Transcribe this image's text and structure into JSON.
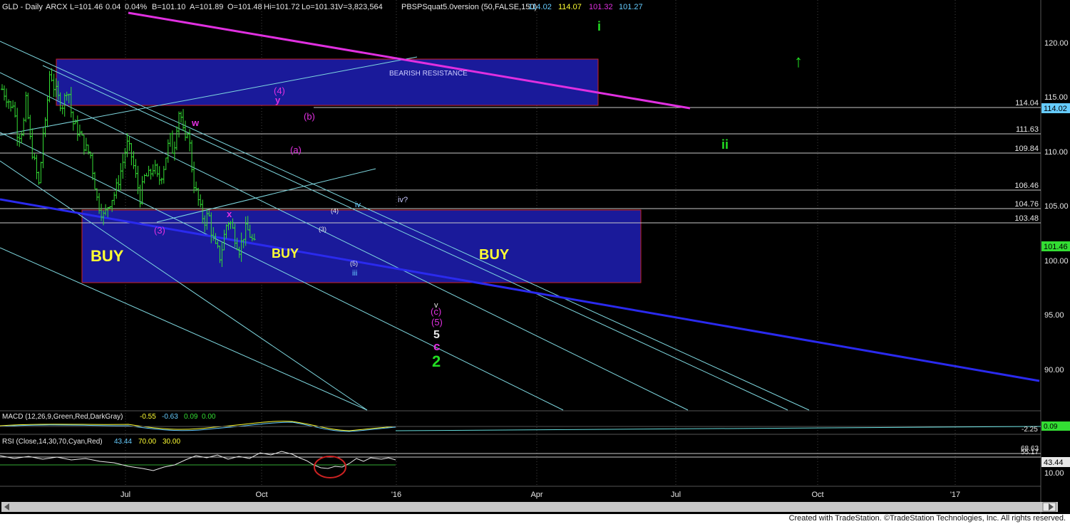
{
  "header": {
    "symbol": "GLD - Daily",
    "exchange": "ARCX",
    "last": "L=101.46",
    "change": "0.04",
    "change_pct": "0.04%",
    "bid": "B=101.10",
    "ask": "A=101.89",
    "open": "O=101.48",
    "high": "Hi=101.72",
    "low": "Lo=101.31",
    "volume": "V=3,823,564",
    "study": "PBSPSquat5.0version (50,FALSE,150)",
    "study_values": [
      "114.02",
      "114.07",
      "101.32",
      "101.27"
    ]
  },
  "price_axis": {
    "ticks": [
      "120.00",
      "115.00",
      "110.00",
      "105.00",
      "100.00",
      "95.00",
      "90.00"
    ],
    "current_price_tag": "101.46",
    "resistance_tag": "114.02"
  },
  "levels": [
    "114.04",
    "111.63",
    "109.84",
    "106.46",
    "104.76",
    "103.48"
  ],
  "time_axis": [
    "Jul",
    "Oct",
    "'16",
    "Apr",
    "Jul",
    "Oct",
    "'17"
  ],
  "annotations": {
    "zone_bearish": "BEARISH RESISTANCE",
    "buy_left": "BUY",
    "buy_mid": "BUY",
    "buy_right": "BUY",
    "wave_i": "i",
    "wave_ii": "ii",
    "arrow_up": "↑",
    "w": "w",
    "x": "x",
    "y": "y",
    "w4": "(4)",
    "w3": "(3)",
    "b": "(b)",
    "a": "(a)",
    "iv": "iv",
    "iv_q": "iv?",
    "sub3": "(3)",
    "sub4": "(4)",
    "sub5": "(5)",
    "iii": "iii",
    "v_small": "v",
    "c_paren": "(c)",
    "five_paren": "(5)",
    "five": "5",
    "c": "c",
    "two": "2"
  },
  "macd": {
    "label": "MACD (12,26,9,Green,Red,DarkGray)",
    "values": [
      "-0.55",
      "-0.63",
      "0.09",
      "0.00"
    ],
    "axis_label": "-2.25",
    "tag": "0.09"
  },
  "rsi": {
    "label": "RSI (Close,14,30,70,Cyan,Red)",
    "values": [
      "43.44",
      "70.00",
      "30.00"
    ],
    "axis_labels": [
      "68.63",
      "55.17",
      "10.00"
    ],
    "tag": "43.44"
  },
  "footer": "Created with TradeStation. ©TradeStation Technologies, Inc. All rights reserved.",
  "colors": {
    "background": "#000000",
    "zone_fill": "#1a1a9a",
    "zone_border": "#cc2222",
    "magenta": "#e030e0",
    "blue_trend": "#2a2aee",
    "cyan": "#7fd8e0",
    "level": "#c8c8c8",
    "buy_text": "#ffff33",
    "wave_green": "#22dd22",
    "price_bar": "#33dd33"
  },
  "chart_data": {
    "type": "bar",
    "symbol": "GLD",
    "period": "Daily",
    "x": [
      "Jul",
      "Oct",
      "'16",
      "Apr",
      "Jul",
      "Oct",
      "'17"
    ],
    "ylim": [
      87.5,
      121.5
    ],
    "price_path": [
      {
        "t": 0,
        "price": 116.0
      },
      {
        "t": 0.14,
        "price": 115.0
      },
      {
        "t": 0.2,
        "price": 114.0
      },
      {
        "t": 0.26,
        "price": 115.2
      },
      {
        "t": 0.3,
        "price": 112.5
      },
      {
        "t": 0.36,
        "price": 111.8
      },
      {
        "t": 0.43,
        "price": 112.2
      },
      {
        "t": 0.48,
        "price": 113.0
      },
      {
        "t": 0.54,
        "price": 115.5
      },
      {
        "t": 0.59,
        "price": 112.0
      },
      {
        "t": 0.7,
        "price": 109.5
      },
      {
        "t": 0.82,
        "price": 107.0
      },
      {
        "t": 0.9,
        "price": 112.0
      },
      {
        "t": 0.95,
        "price": 112.5
      },
      {
        "t": 1.0,
        "price": 115.0
      },
      {
        "t": 1.06,
        "price": 118.0
      },
      {
        "t": 1.12,
        "price": 116.5
      },
      {
        "t": 1.25,
        "price": 115.0
      },
      {
        "t": 1.35,
        "price": 114.5
      },
      {
        "t": 1.45,
        "price": 116.5
      },
      {
        "t": 1.55,
        "price": 113.0
      },
      {
        "t": 1.7,
        "price": 112.0
      },
      {
        "t": 1.85,
        "price": 110.5
      },
      {
        "t": 1.95,
        "price": 110.0
      },
      {
        "t": 2.1,
        "price": 105.8
      },
      {
        "t": 2.25,
        "price": 104.2
      },
      {
        "t": 2.35,
        "price": 105.5
      },
      {
        "t": 2.5,
        "price": 106.5
      },
      {
        "t": 2.65,
        "price": 109.0
      },
      {
        "t": 2.75,
        "price": 111.0
      },
      {
        "t": 2.85,
        "price": 110.0
      },
      {
        "t": 2.95,
        "price": 108.0
      },
      {
        "t": 3.05,
        "price": 106.0
      },
      {
        "t": 3.15,
        "price": 108.0
      },
      {
        "t": 3.25,
        "price": 108.0
      },
      {
        "t": 3.35,
        "price": 109.0
      },
      {
        "t": 3.45,
        "price": 107.5
      },
      {
        "t": 3.55,
        "price": 108.5
      },
      {
        "t": 3.65,
        "price": 110.5
      },
      {
        "t": 3.72,
        "price": 111.5
      },
      {
        "t": 3.78,
        "price": 110.0
      },
      {
        "t": 3.85,
        "price": 112.5
      },
      {
        "t": 3.9,
        "price": 114.0
      },
      {
        "t": 3.95,
        "price": 113.5
      },
      {
        "t": 4.0,
        "price": 112.0
      },
      {
        "t": 4.05,
        "price": 111.0
      },
      {
        "t": 4.1,
        "price": 112.5
      },
      {
        "t": 4.15,
        "price": 110.5
      },
      {
        "t": 4.2,
        "price": 108.5
      },
      {
        "t": 4.25,
        "price": 107.0
      },
      {
        "t": 4.32,
        "price": 106.0
      },
      {
        "t": 4.4,
        "price": 104.5
      },
      {
        "t": 4.5,
        "price": 103.8
      },
      {
        "t": 4.55,
        "price": 104.8
      },
      {
        "t": 4.62,
        "price": 103.0
      },
      {
        "t": 4.7,
        "price": 101.5
      },
      {
        "t": 4.78,
        "price": 101.0
      },
      {
        "t": 4.82,
        "price": 100.5
      },
      {
        "t": 4.88,
        "price": 102.0
      },
      {
        "t": 4.95,
        "price": 103.5
      },
      {
        "t": 5.02,
        "price": 104.0
      },
      {
        "t": 5.1,
        "price": 103.0
      },
      {
        "t": 5.18,
        "price": 102.0
      },
      {
        "t": 5.25,
        "price": 101.2
      },
      {
        "t": 5.32,
        "price": 102.5
      },
      {
        "t": 5.4,
        "price": 103.2
      },
      {
        "t": 5.48,
        "price": 102.6
      },
      {
        "t": 5.55,
        "price": 101.8
      },
      {
        "t": 5.6,
        "price": 101.5
      }
    ]
  }
}
